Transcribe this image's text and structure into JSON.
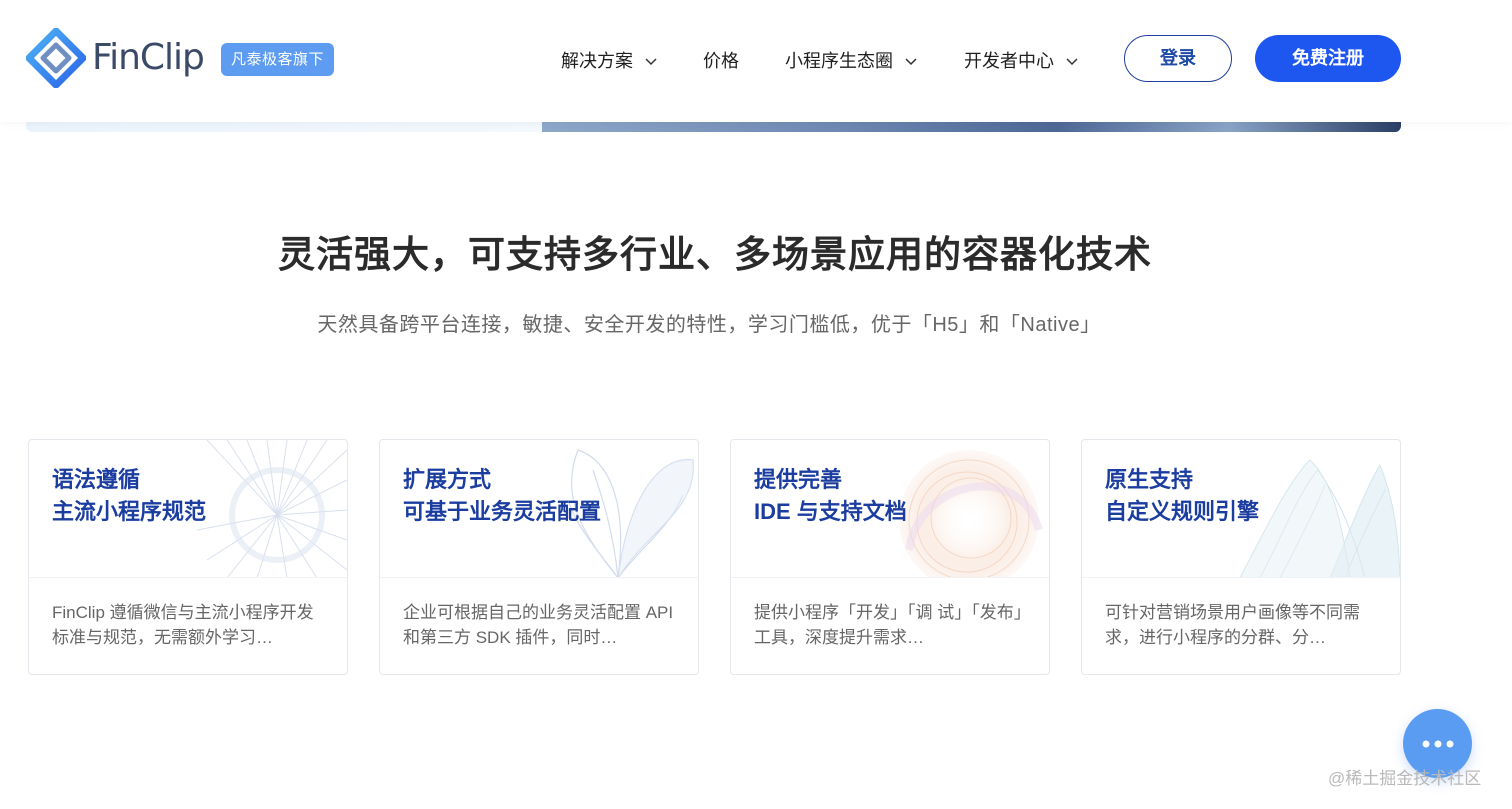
{
  "header": {
    "logo_text": "FinClip",
    "tag": "凡泰极客旗下",
    "nav": [
      {
        "label": "解决方案",
        "has_dropdown": true
      },
      {
        "label": "价格",
        "has_dropdown": false
      },
      {
        "label": "小程序生态圈",
        "has_dropdown": true
      },
      {
        "label": "开发者中心",
        "has_dropdown": true
      }
    ],
    "login_label": "登录",
    "register_label": "免费注册"
  },
  "section": {
    "title": "灵活强大，可支持多行业、多场景应用的容器化技术",
    "subtitle": "天然具备跨平台连接，敏捷、安全开发的特性，学习门槛低，优于「H5」和「Native」"
  },
  "cards": [
    {
      "title_line1": "语法遵循",
      "title_line2": "主流小程序规范",
      "desc": "FinClip 遵循微信与主流小程序开发标准与规范，无需额外学习…"
    },
    {
      "title_line1": "扩展方式",
      "title_line2": "可基于业务灵活配置",
      "desc": "企业可根据自己的业务灵活配置 API 和第三方 SDK 插件，同时…"
    },
    {
      "title_line1": "提供完善",
      "title_line2": "IDE 与支持文档",
      "desc": "提供小程序「开发」「调 试」「发布」工具，深度提升需求…"
    },
    {
      "title_line1": "原生支持",
      "title_line2": "自定义规则引擎",
      "desc": "可针对营销场景用户画像等不同需求，进行小程序的分群、分…"
    }
  ],
  "watermark": "@稀土掘金技术社区",
  "colors": {
    "primary": "#1e56f0",
    "card_title": "#1b3da0",
    "tag_bg": "#5e9cf2",
    "fab_bg": "#5b9cf3"
  },
  "icons": [
    "finclip-logo-icon",
    "chevron-down-icon",
    "more-dots-icon"
  ]
}
